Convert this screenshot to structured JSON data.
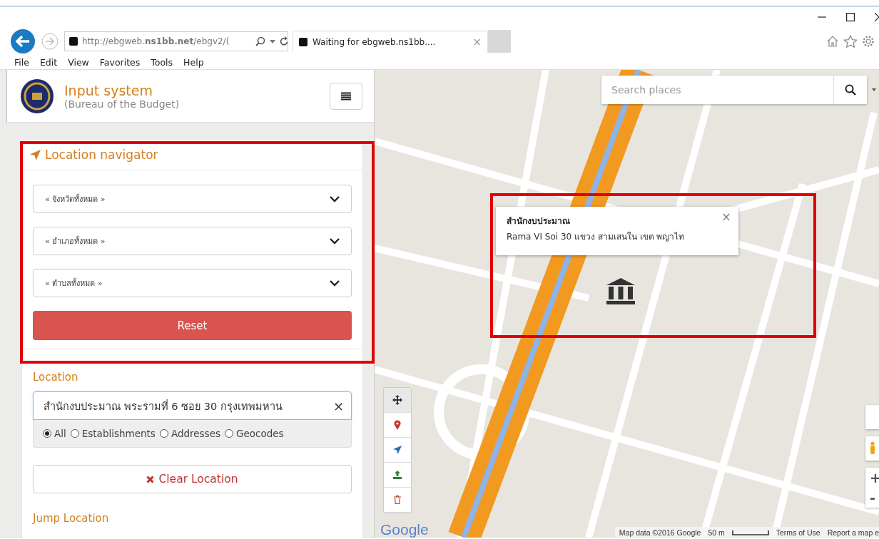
{
  "browser": {
    "address": "http://ebgweb.**ns1bb.net**/ebgv2/(",
    "tab": {
      "title": "Waiting for ebgweb.ns1bb....",
      "close": "×"
    }
  },
  "menu": [
    "File",
    "Edit",
    "View",
    "Favorites",
    "Tools",
    "Help"
  ],
  "header": {
    "title": "Input system",
    "subtitle": "(Bureau of the Budget)"
  },
  "navigator": {
    "heading": "Location navigator",
    "selects": [
      "« จังหวัดทั้งหมด »",
      "« อำเภอทั้งหมด »",
      "« ตำบลทั้งหมด »"
    ],
    "reset": "Reset"
  },
  "location": {
    "label": "Location",
    "value": "สำนักงบประมาณ พระรามที่ 6 ซอย 30 กรุงเทพมหาน",
    "clear": "×",
    "filters": [
      {
        "label": "All",
        "selected": true
      },
      {
        "label": "Establishments",
        "selected": false
      },
      {
        "label": "Addresses",
        "selected": false
      },
      {
        "label": "Geocodes",
        "selected": false
      }
    ],
    "clear_button": "Clear Location",
    "jump_label": "Jump Location"
  },
  "map": {
    "search": {
      "placeholder": "Search places"
    },
    "popup": {
      "title": "สำนักงบประมาณ",
      "address": "Rama VI Soi 30 แขวง สามเสนใน เขต พญาไท",
      "close": "×"
    },
    "tools": [
      {
        "kind": "move"
      },
      {
        "kind": "pin"
      },
      {
        "kind": "arrow"
      },
      {
        "kind": "upload"
      },
      {
        "kind": "trash"
      }
    ],
    "zoom": [
      "+",
      "-"
    ],
    "logo": "Google",
    "footer": [
      "Map data ©2016 Google",
      "50 m",
      "Terms of Use",
      "Report a map e"
    ]
  }
}
